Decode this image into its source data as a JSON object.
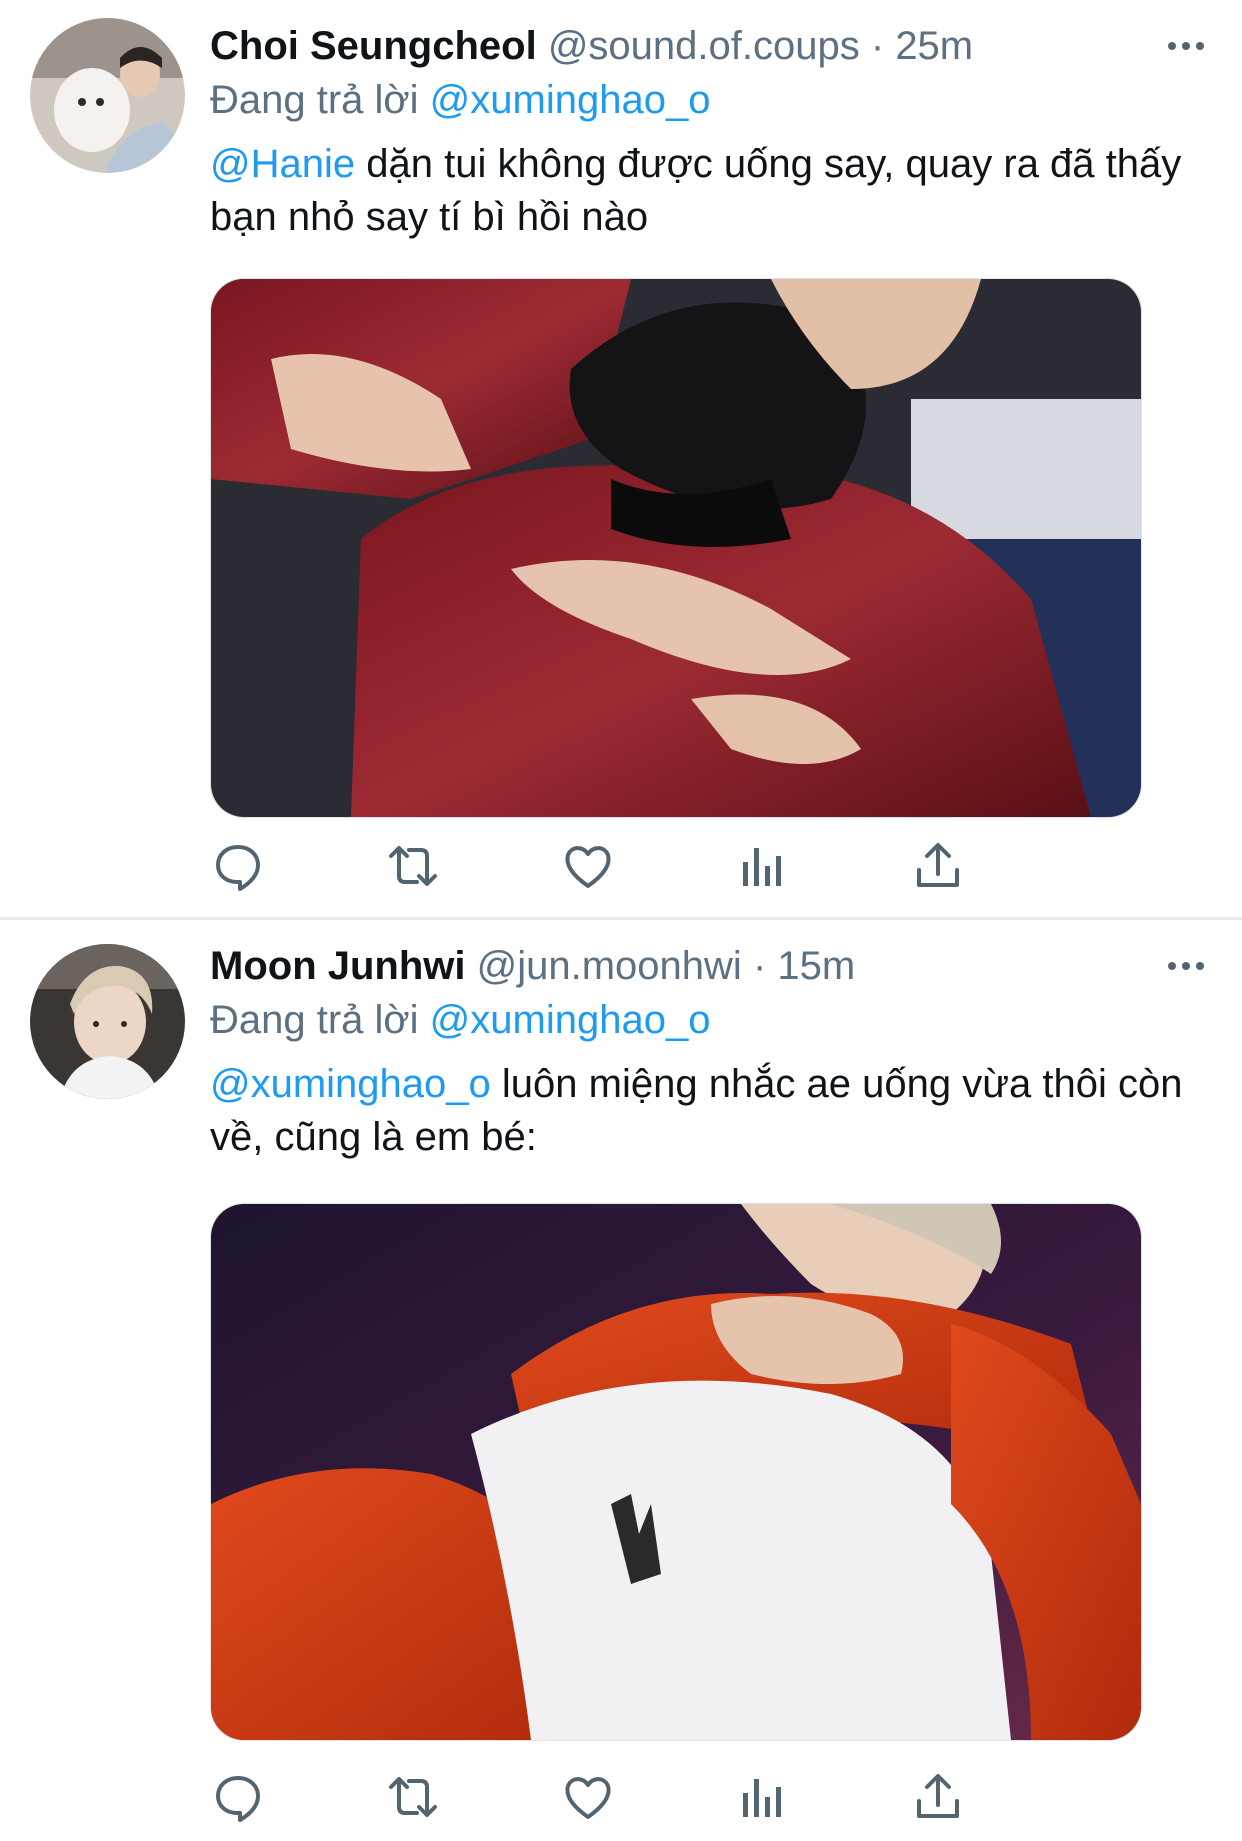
{
  "colors": {
    "link": "#1d9bf0",
    "secondary_text": "#5b7083",
    "primary_text": "#0f1419",
    "icon": "#536471",
    "divider": "#e6ecf0"
  },
  "tweets": [
    {
      "display_name": "Choi Seungcheol",
      "handle": "@sound.of.coups",
      "separator": "·",
      "time": "25m",
      "reply_label": "Đang trả lời",
      "reply_to": "@xuminghao_o",
      "mention": "@Hanie",
      "body": " dặn tui không được uống say, quay ra đã thấy bạn nhỏ say tí bì hồi nào",
      "avatar_icon": "profile-photo",
      "media_icon": "photo",
      "action_icons": [
        "reply-icon",
        "retweet-icon",
        "like-icon",
        "analytics-icon",
        "share-icon"
      ]
    },
    {
      "display_name": "Moon Junhwi",
      "handle": "@jun.moonhwi",
      "separator": "·",
      "time": "15m",
      "reply_label": "Đang trả lời",
      "reply_to": "@xuminghao_o",
      "mention": "@xuminghao_o",
      "body": " luôn miệng nhắc ae uống vừa thôi còn về, cũng là em bé:",
      "avatar_icon": "profile-photo",
      "media_icon": "photo",
      "action_icons": [
        "reply-icon",
        "retweet-icon",
        "like-icon",
        "analytics-icon",
        "share-icon"
      ]
    }
  ]
}
